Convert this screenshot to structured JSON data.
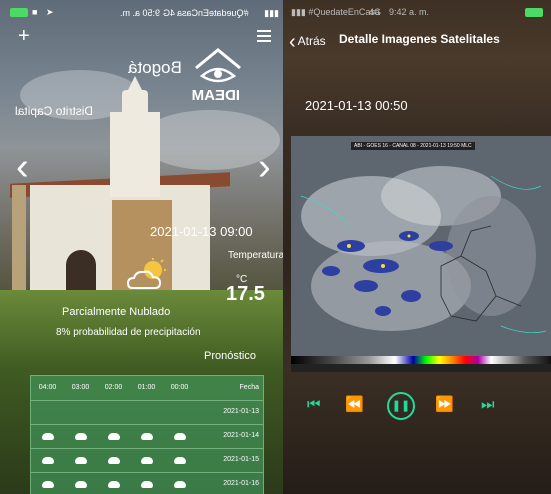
{
  "left_screen": {
    "status_bar": {
      "time": "9:50 a. m.",
      "network": "4G",
      "carrier": "#QuedateEnCasa"
    },
    "brand": {
      "logo_text": "IDEAM"
    },
    "location": {
      "city": "Bogotá",
      "department": "Distrito Capital"
    },
    "reading": {
      "datetime": "2021-01-13 09:00",
      "temperature_label": "Temperatura",
      "unit": "°C",
      "temperature": "17.5",
      "condition": "Parcialmente Nublado",
      "precip_probability": "8% probabilidad de precipitación"
    },
    "forecast": {
      "title": "Pronóstico",
      "header_label": "Fecha",
      "hours": [
        "00:00",
        "01:00",
        "02:00",
        "03:00",
        "04:00"
      ],
      "dates": [
        "2021-01-13",
        "2021-01-14",
        "2021-01-15",
        "2021-01-16"
      ]
    },
    "icons": [
      "plus-icon",
      "menu-icon",
      "chevron-left-icon",
      "chevron-right-icon",
      "partly-cloudy-icon",
      "cloud-icon"
    ]
  },
  "right_screen": {
    "status_bar": {
      "carrier": "#QuedateEnCasa",
      "network": "4G",
      "time": "9:42 a. m."
    },
    "nav": {
      "back_label": "Atrás",
      "title": "Detalle Imagenes Satelitales"
    },
    "image_datetime": "2021-01-13 00:50",
    "satellite_header": "ABI - GOES 16 - CANAL 08 - 2021-01-13 19:50 MLC",
    "controls": [
      "skip-start-icon",
      "rewind-icon",
      "pause-icon",
      "fast-forward-icon",
      "skip-end-icon"
    ],
    "accent_color": "#1fdc9a"
  }
}
